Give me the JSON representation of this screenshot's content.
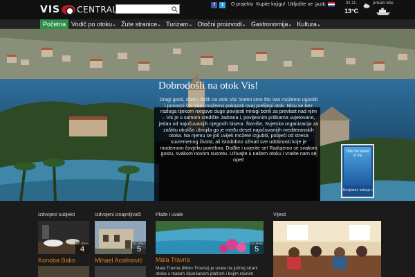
{
  "logo": {
    "vis": "VIS",
    "central": "CENTRAL"
  },
  "search": {
    "value": "",
    "placeholder": ""
  },
  "toplinks": {
    "about": "O projektu",
    "buy_book": "Kupite knjigu!",
    "join": "Uključite se",
    "language": "jezik:"
  },
  "weather": {
    "date": "02.11.",
    "temp": "13°C",
    "icon": "cloud-icon"
  },
  "ferry": {
    "label": "prikaži više"
  },
  "nav": {
    "items": [
      {
        "label": "Početna",
        "active": true
      },
      {
        "label": "Vodič po otoku"
      },
      {
        "label": "Žute stranice"
      },
      {
        "label": "Turizam"
      },
      {
        "label": "Otočni proizvodi"
      },
      {
        "label": "Gastronomija"
      },
      {
        "label": "Kultura"
      }
    ]
  },
  "hero": {
    "title": "Dobrodošli na otok Vis!",
    "text": "Dragi gosti, dobro došli na otok Vis! Sretni smo što Vas možemo ugostiti i ponosni što Vam možemo pokazati ovaj prelijepi otok. Nisu se bez razloga tijekom njegove duge povijesti mnogi borili za prevlast nad njim – Vis je u samom središte Jadrana i, povijesnim prilikama uvjetovano, jedan od najočuvanijih njegovih bisera. Štoviše, Svjetska organizacija za zaštitu okoliša ubrojila ga je među deset najočuvanijih mediteranskih otoka. Na njemu se još uvijek možete izgubiti, pobjeći od stresa suvremenog života, ali istodobno uživati sve udobnosti koje je modernom čovjeku potrebna. Dođite i uvjerite se! Radujemo se svakom gostu, svakom novom susretu. Uživajte u našem otoku i vratite nam se opet!",
    "download": {
      "cover_title": "Otok Vis Island of Vis",
      "label": "Besplatno izdanje »"
    }
  },
  "lower": {
    "featured_businesses": {
      "title": "Izdvojeni subjekti",
      "name": "Konoba Bako",
      "rating_label": "OCJENA",
      "rating": "4"
    },
    "featured_rentals": {
      "title": "Izdvojeni iznajmljivači",
      "name": "Mihael Acalinović",
      "rating_label": "OCJENA",
      "rating": "5"
    },
    "beaches": {
      "title": "Plaže i uvale",
      "name": "Mala Travna",
      "rating_label": "OCJENA",
      "rating": "5",
      "text": "Mala Travna (Molo Trovna) je uvala na južnoj strani otoka s malom šljunčanom plažom i kojim ravnim"
    },
    "news": {
      "title": "Vijesti"
    }
  },
  "colors": {
    "accent_green": "#2e8f4f",
    "name_orange": "#e07a1a",
    "header_bg": "#111111"
  }
}
